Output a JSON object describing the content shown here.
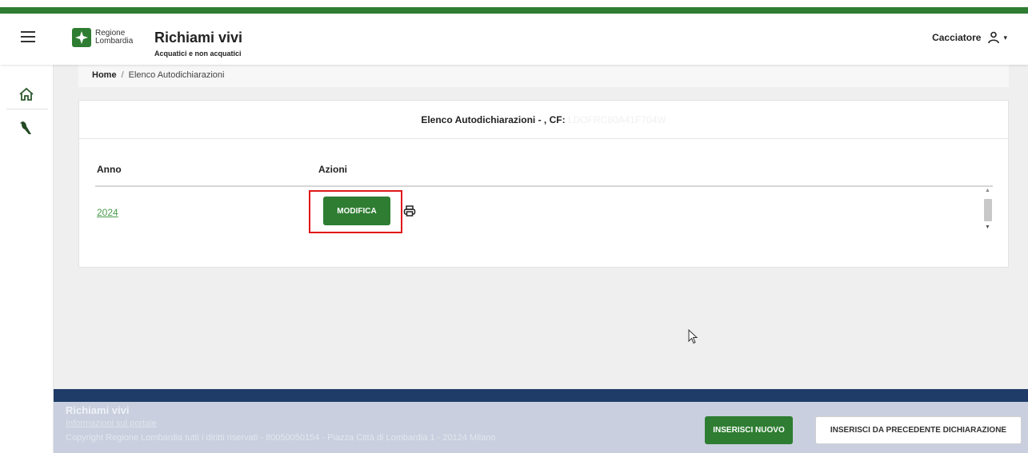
{
  "app": {
    "title": "Richiami vivi",
    "subtitle": "Acquatici e non acquatici",
    "logo_line1": "Regione",
    "logo_line2": "Lombardia"
  },
  "user": {
    "name": "Cacciatore"
  },
  "breadcrumb": {
    "home": "Home",
    "separator": "/",
    "current": "Elenco Autodichiarazioni"
  },
  "card": {
    "title": "Elenco Autodichiarazioni - , CF:",
    "cf_value": "LDOFRC80A41F704W"
  },
  "table": {
    "headers": [
      "Anno",
      "Azioni"
    ],
    "rows": [
      {
        "anno": "2024",
        "action_label": "MODIFICA"
      }
    ]
  },
  "footer": {
    "title": "Richiami vivi",
    "link": "Informazioni sul portale",
    "copyright": "Copyright Regione Lombardia tutti i diritti riservati - 80050050154 - Piazza Città di Lombardia 1 - 20124 Milano",
    "btn_new": "INSERISCI NUOVO",
    "btn_prev": "INSERISCI DA PRECEDENTE DICHIARAZIONE"
  },
  "icons": {
    "menu": "hamburger-icon",
    "home": "home-icon",
    "bird": "bird-icon",
    "user": "user-icon",
    "print": "print-icon",
    "cursor": "mouse-cursor-icon"
  },
  "colors": {
    "brand_green": "#2e7d32",
    "footer_navy": "#1f3c68",
    "highlight_red": "#e01818"
  }
}
